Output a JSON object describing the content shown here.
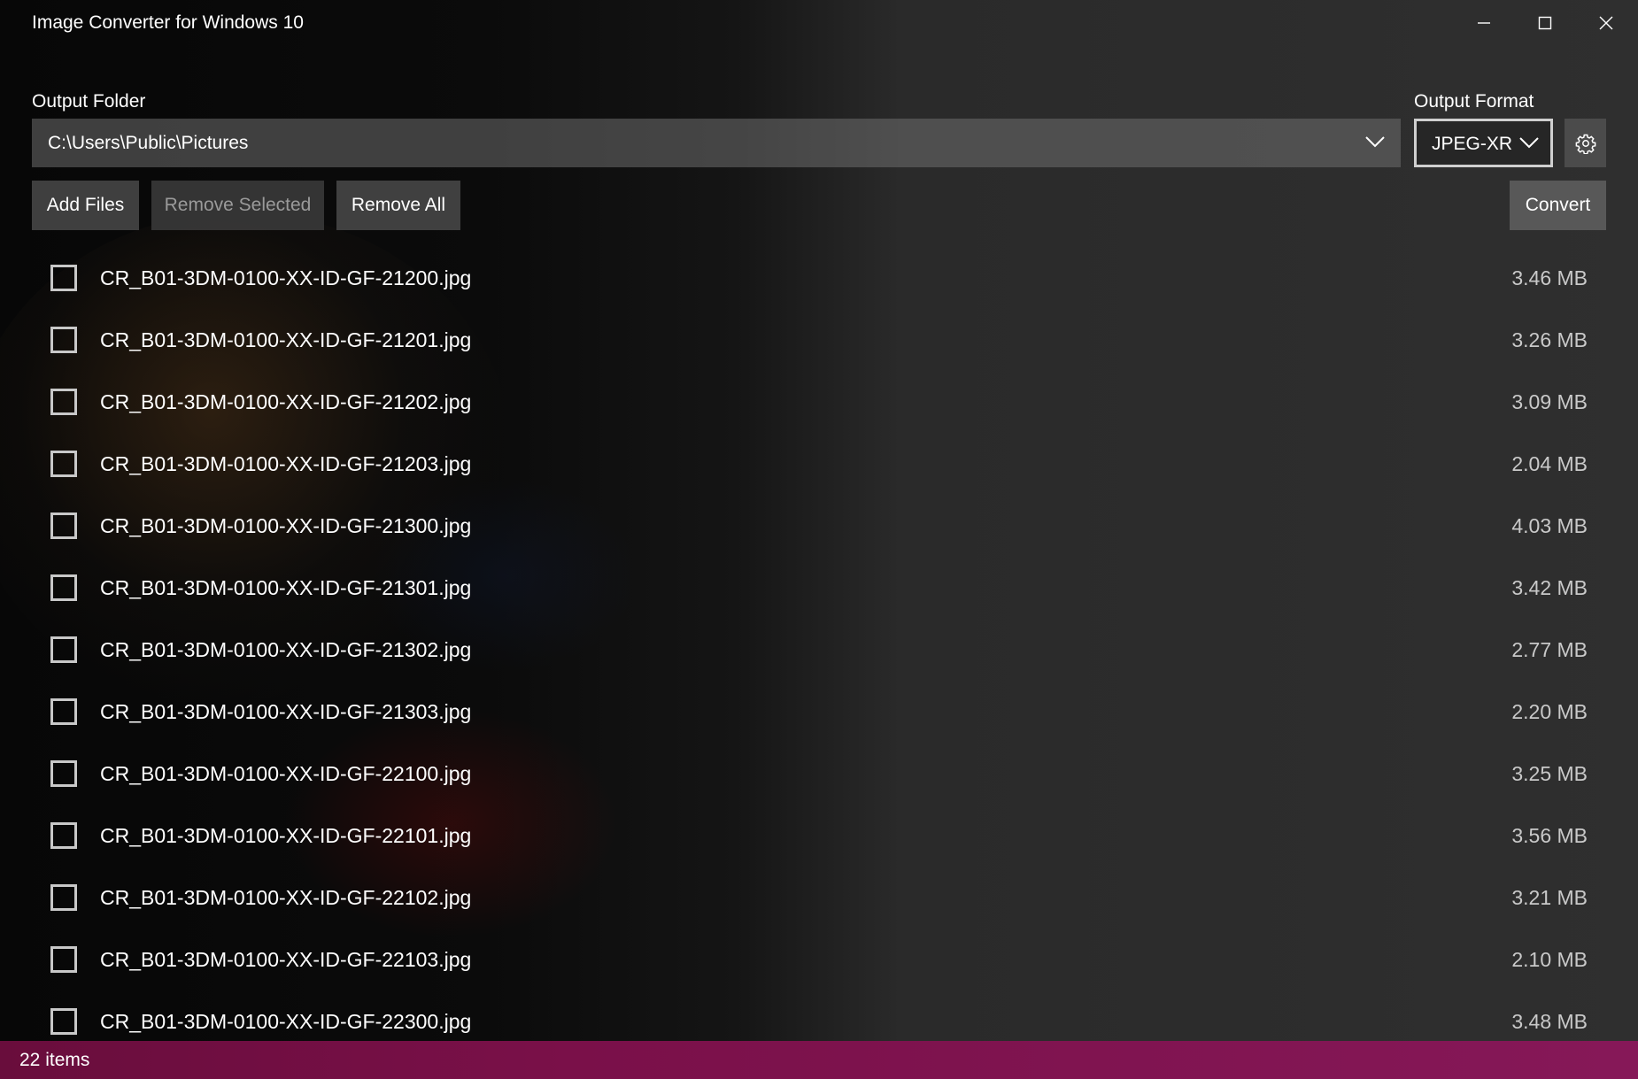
{
  "window": {
    "title": "Image Converter for Windows 10",
    "controls": [
      "minimize-icon",
      "maximize-icon",
      "close-icon"
    ]
  },
  "output_folder": {
    "label": "Output Folder",
    "value": "C:\\Users\\Public\\Pictures"
  },
  "output_format": {
    "label": "Output Format",
    "value": "JPEG-XR"
  },
  "toolbar": {
    "add_files": "Add Files",
    "remove_selected": "Remove Selected",
    "remove_all": "Remove All",
    "convert": "Convert"
  },
  "files": [
    {
      "name": "CR_B01-3DM-0100-XX-ID-GF-21200.jpg",
      "size": "3.46 MB",
      "checked": false
    },
    {
      "name": "CR_B01-3DM-0100-XX-ID-GF-21201.jpg",
      "size": "3.26 MB",
      "checked": false
    },
    {
      "name": "CR_B01-3DM-0100-XX-ID-GF-21202.jpg",
      "size": "3.09 MB",
      "checked": false
    },
    {
      "name": "CR_B01-3DM-0100-XX-ID-GF-21203.jpg",
      "size": "2.04 MB",
      "checked": false
    },
    {
      "name": "CR_B01-3DM-0100-XX-ID-GF-21300.jpg",
      "size": "4.03 MB",
      "checked": false
    },
    {
      "name": "CR_B01-3DM-0100-XX-ID-GF-21301.jpg",
      "size": "3.42 MB",
      "checked": false
    },
    {
      "name": "CR_B01-3DM-0100-XX-ID-GF-21302.jpg",
      "size": "2.77 MB",
      "checked": false
    },
    {
      "name": "CR_B01-3DM-0100-XX-ID-GF-21303.jpg",
      "size": "2.20 MB",
      "checked": false
    },
    {
      "name": "CR_B01-3DM-0100-XX-ID-GF-22100.jpg",
      "size": "3.25 MB",
      "checked": false
    },
    {
      "name": "CR_B01-3DM-0100-XX-ID-GF-22101.jpg",
      "size": "3.56 MB",
      "checked": false
    },
    {
      "name": "CR_B01-3DM-0100-XX-ID-GF-22102.jpg",
      "size": "3.21 MB",
      "checked": false
    },
    {
      "name": "CR_B01-3DM-0100-XX-ID-GF-22103.jpg",
      "size": "2.10 MB",
      "checked": false
    },
    {
      "name": "CR_B01-3DM-0100-XX-ID-GF-22300.jpg",
      "size": "3.48 MB",
      "checked": false
    }
  ],
  "status": {
    "text": "22 items"
  },
  "colors": {
    "status_bar": "#7a1049",
    "text": "#ffffff",
    "button": "#464646"
  }
}
